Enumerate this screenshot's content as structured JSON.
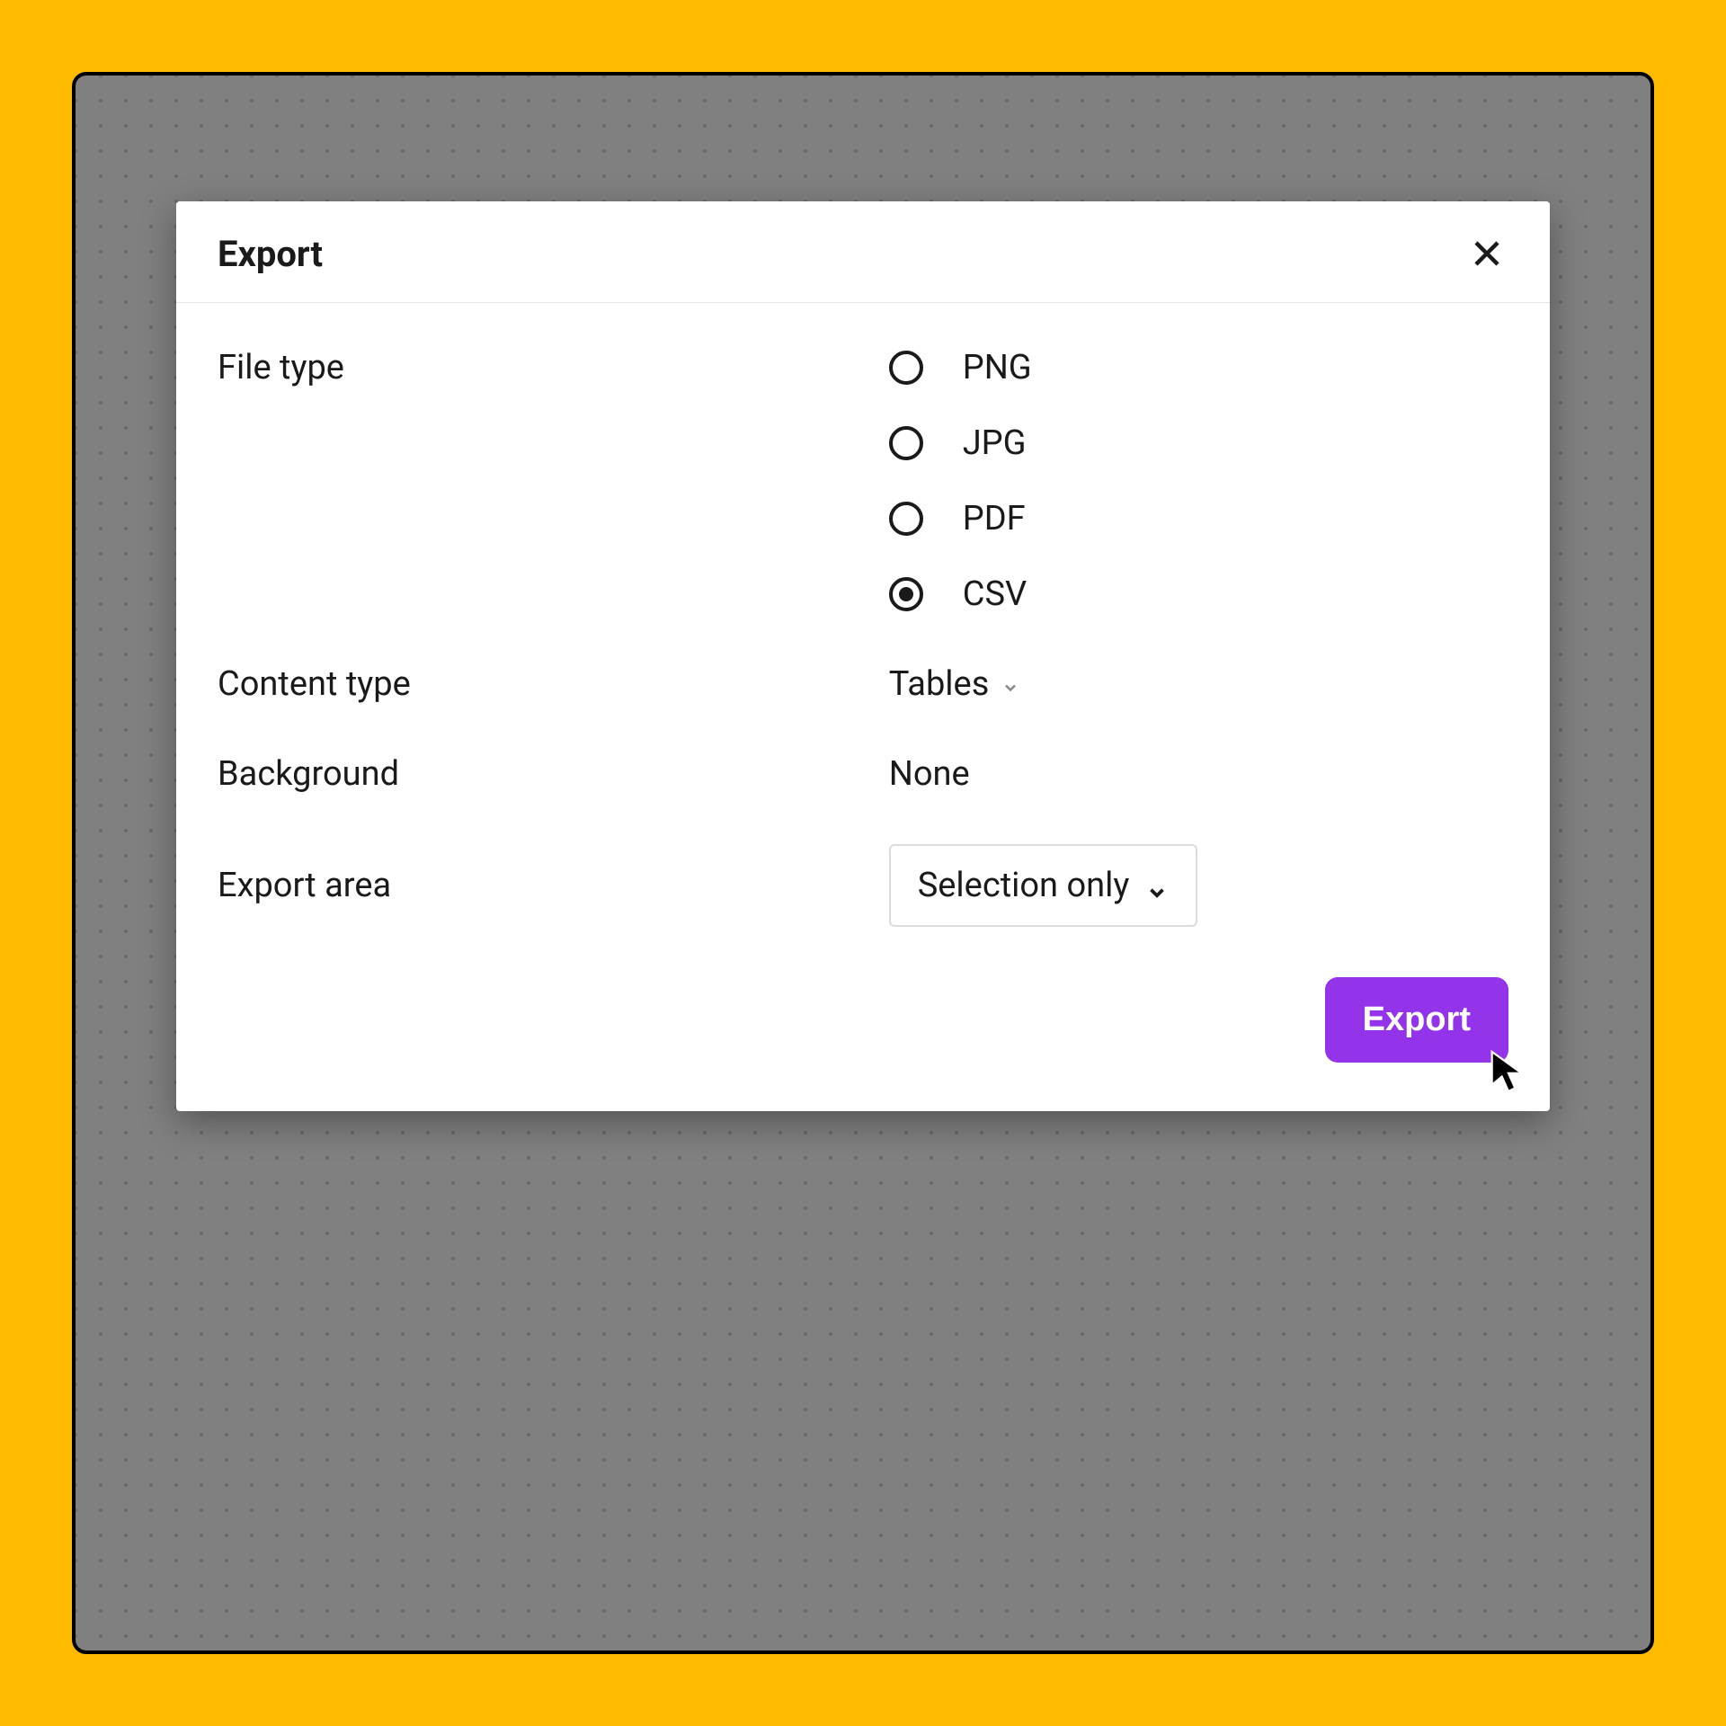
{
  "dialog": {
    "title": "Export",
    "file_type": {
      "label": "File type",
      "options": [
        "PNG",
        "JPG",
        "PDF",
        "CSV"
      ],
      "selected": "CSV"
    },
    "content_type": {
      "label": "Content type",
      "value": "Tables"
    },
    "background": {
      "label": "Background",
      "value": "None"
    },
    "export_area": {
      "label": "Export area",
      "value": "Selection only"
    },
    "submit_label": "Export"
  },
  "colors": {
    "accent": "#9333ea",
    "page_bg": "#ffbb00",
    "canvas_bg": "#808080"
  }
}
